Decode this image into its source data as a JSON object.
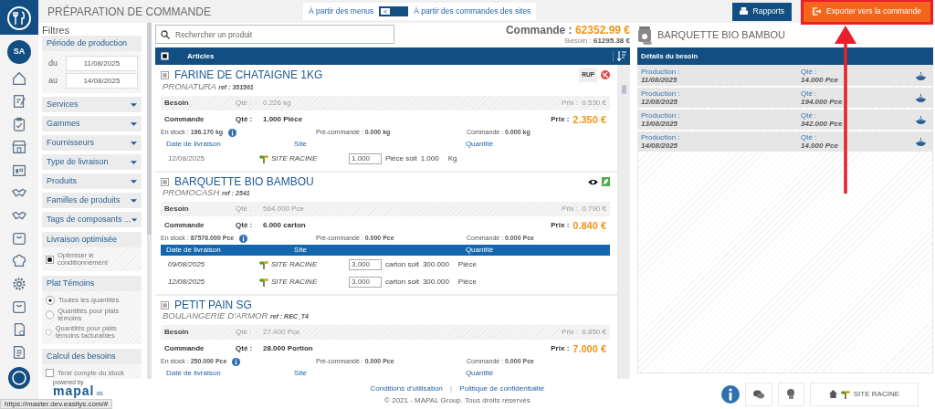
{
  "header": {
    "title": "PRÉPARATION DE COMMANDE",
    "source_toggle": {
      "left_label": "À partir des menus",
      "switch_label": "<",
      "on": false,
      "right_label": "À partir des commandes des sites"
    },
    "buttons": [
      {
        "kind": "reports",
        "label": "Rapports",
        "highlighted": false
      },
      {
        "kind": "export",
        "label": "Exporter vers la commande",
        "highlighted": true
      }
    ]
  },
  "user": {
    "initials": "SA"
  },
  "filters": {
    "title": "Filtres",
    "period": {
      "title": "Période de production",
      "from_label": "du",
      "from": "11/08/2025",
      "to_label": "au",
      "to": "14/08/2025"
    },
    "dropdowns": [
      "Services",
      "Gammes",
      "Fournisseurs",
      "Type de livraison",
      "Produits",
      "Familles de produits",
      "Tags de composants ..."
    ],
    "sections": [
      {
        "title": "Livraison optimisée",
        "options": [
          {
            "kind": "checkbox",
            "label": "Optimiser le conditionnement",
            "checked": true
          }
        ]
      },
      {
        "title": "Plat Témoins",
        "options": [
          {
            "kind": "radio",
            "label": "Toutes les quantités",
            "selected": true
          },
          {
            "kind": "radio",
            "label": "Quantités pour plats témoins",
            "selected": false
          },
          {
            "kind": "radio",
            "label": "Quantités pour plats témoins facturables",
            "selected": false
          }
        ]
      },
      {
        "title": "Calcul des besoins",
        "options": [
          {
            "kind": "checkbox",
            "label": "Tenir compte du stock",
            "checked": false
          }
        ]
      }
    ]
  },
  "articles": {
    "search_placeholder": "Rechercher un produit",
    "order_total_label": "Commande :",
    "order_total": "62352.99 €",
    "need_total_label": "Besoin :",
    "need_total": "61295.38 €",
    "header": "Articles",
    "select_all_checked": true,
    "items": [
      {
        "name": "FARINE DE CHATAIGNE 1KG",
        "supplier": "PRONATURA",
        "ref": "ref : 351561",
        "checked": false,
        "selected": false,
        "badges": [
          {
            "kind": "text",
            "label": "RUP"
          },
          {
            "kind": "allergen"
          }
        ],
        "need": {
          "label": "Besoin",
          "qty_label": "Qté :",
          "qty": "0.226 kg",
          "price_label": "Prix :",
          "price": "0.530 €"
        },
        "order": {
          "label": "Commande",
          "qty_label": "Qté :",
          "qty": "1.000 Pièce",
          "price_label": "Prix :",
          "price": "2.350 €"
        },
        "stock": [
          "En stock : **196.170 kg**",
          "Pré-commandé : **0.000 kg**",
          "Commandé : **0.000 kg**"
        ],
        "delivery_columns": [
          "Date de livraison",
          "Site",
          "Quantité"
        ],
        "deliveries": [
          {
            "date": "12/08/2025",
            "site": "SITE RACINE",
            "quantity": "1.000",
            "unit": "Pièce soit",
            "converted": "1.000",
            "converted_unit": "Kg"
          }
        ]
      },
      {
        "name": "BARQUETTE BIO BAMBOU",
        "supplier": "PROMOCASH",
        "ref": "ref : 2541",
        "checked": false,
        "selected": true,
        "badges": [
          {
            "kind": "eye"
          },
          {
            "kind": "bio"
          }
        ],
        "need": {
          "label": "Besoin",
          "qty_label": "Qté :",
          "qty": "564.000 Pce",
          "price_label": "Prix :",
          "price": "0.790 €"
        },
        "order": {
          "label": "Commande",
          "qty_label": "Qté :",
          "qty": "6.000 carton",
          "price_label": "Prix :",
          "price": "0.840 €"
        },
        "stock": [
          "En stock : **87576.000 Pce**",
          "Pré-commandé : **0.000 Pce**",
          "Commandé : **0.000 Pce**"
        ],
        "delivery_columns": [
          "Date de livraison",
          "Site",
          "Quantité"
        ],
        "deliveries": [
          {
            "date": "09/08/2025",
            "site": "SITE RACINE",
            "quantity": "3.000",
            "unit": "carton soit",
            "converted": "300.000",
            "converted_unit": "Pièce"
          },
          {
            "date": "12/08/2025",
            "site": "SITE RACINE",
            "quantity": "3.000",
            "unit": "carton soit",
            "converted": "300.000",
            "converted_unit": "Pièce"
          }
        ]
      },
      {
        "name": "PETIT PAIN SG",
        "supplier": "BOULANGERIE D'ARMOR",
        "ref": "ref : REC_T4",
        "checked": false,
        "selected": false,
        "need": {
          "label": "Besoin",
          "qty_label": "Qté :",
          "qty": "27.400 Pce",
          "price_label": "Prix :",
          "price": "6.850 €"
        },
        "order": {
          "label": "Commande",
          "qty_label": "Qté :",
          "qty": "28.000 Portion",
          "price_label": "Prix :",
          "price": "7.000 €"
        },
        "stock": [
          "En stock : **250.000 Pce**",
          "Pré-commandé : **0.000 Pce**",
          "Commandé : **0.000 Pce**"
        ],
        "delivery_columns": [
          "Date de livraison",
          "Site",
          "Quantité"
        ]
      }
    ]
  },
  "details": {
    "title": "BARQUETTE BIO BAMBOU",
    "header": "Détails du besoin",
    "rows": [
      {
        "production_label": "Production :",
        "date": "11/08/2025",
        "qty_label": "Qté :",
        "qty": "14.000 Pce"
      },
      {
        "production_label": "Production :",
        "date": "12/08/2025",
        "qty_label": "Qté :",
        "qty": "194.000 Pce"
      },
      {
        "production_label": "Production :",
        "date": "13/08/2025",
        "qty_label": "Qté :",
        "qty": "342.000 Pce"
      },
      {
        "production_label": "Production :",
        "date": "14/08/2025",
        "qty_label": "Qté :",
        "qty": "14.000 Pce"
      }
    ]
  },
  "footer": {
    "powered_by": "powered by",
    "brand": "mapal",
    "brand_suffix": "os",
    "links": [
      "Conditions d'utilisation",
      "Politique de confidentialité"
    ],
    "separator": "|",
    "copyright": "© 2021 - MAPAL Group. Tous droits réservés",
    "site": "SITE RACINE"
  },
  "status_bar": {
    "url": "https://master.dev.easilys.com/#"
  }
}
